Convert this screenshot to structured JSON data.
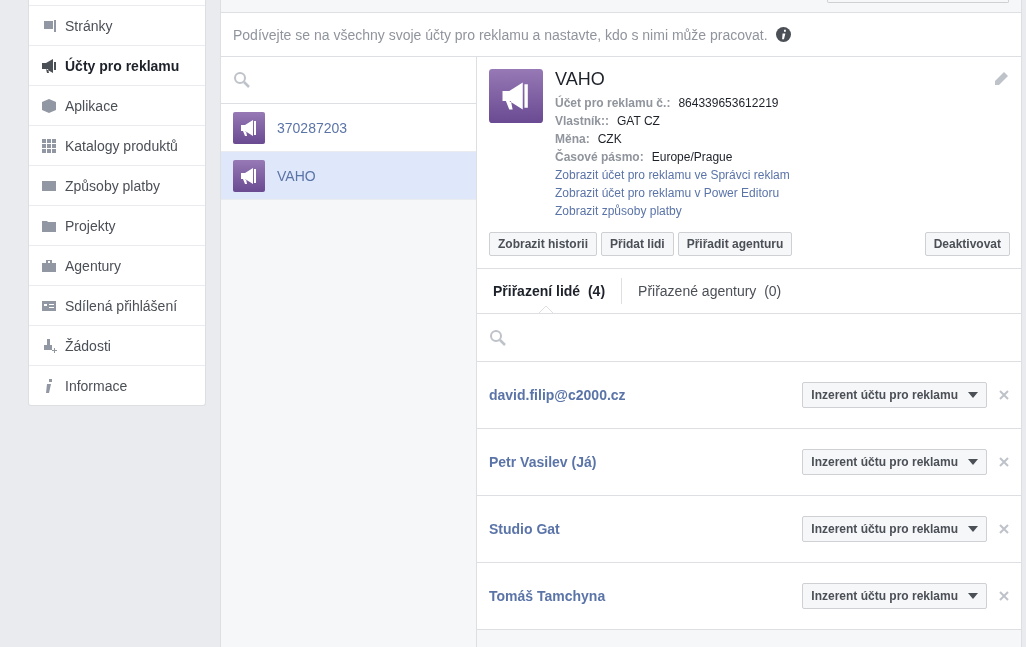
{
  "sidebar": {
    "items": [
      {
        "label": "Stránky",
        "kind": "flag",
        "selected": false
      },
      {
        "label": "Účty pro reklamu",
        "kind": "megaphone",
        "selected": true
      },
      {
        "label": "Aplikace",
        "kind": "cube",
        "selected": false
      },
      {
        "label": "Katalogy produktů",
        "kind": "grid",
        "selected": false
      },
      {
        "label": "Způsoby platby",
        "kind": "card",
        "selected": false
      },
      {
        "label": "Projekty",
        "kind": "folder",
        "selected": false
      },
      {
        "label": "Agentury",
        "kind": "briefcase",
        "selected": false
      },
      {
        "label": "Sdílená přihlášení",
        "kind": "idcard",
        "selected": false
      },
      {
        "label": "Žádosti",
        "kind": "personadd",
        "selected": false
      },
      {
        "label": "Informace",
        "kind": "info",
        "selected": false
      }
    ]
  },
  "description": "Podívejte se na všechny svoje účty pro reklamu a nastavte, kdo s nimi může pracovat.",
  "accounts": [
    {
      "name": "370287203",
      "selected": false
    },
    {
      "name": "VAHO",
      "selected": true
    }
  ],
  "detail": {
    "title": "VAHO",
    "fields": [
      {
        "label": "Účet pro reklamu č.:",
        "value": "864339653612219"
      },
      {
        "label": "Vlastník::",
        "value": "GAT CZ"
      },
      {
        "label": "Měna:",
        "value": "CZK"
      },
      {
        "label": "Časové pásmo:",
        "value": "Europe/Prague"
      }
    ],
    "links": [
      "Zobrazit účet pro reklamu ve Správci reklam",
      "Zobrazit účet pro reklamu v Power Editoru",
      "Zobrazit způsoby platby"
    ],
    "buttons": [
      "Zobrazit historii",
      "Přidat lidi",
      "Přiřadit agenturu"
    ],
    "deactivate_button": "Deaktivovat"
  },
  "tabs": [
    {
      "label": "Přiřazení lidé",
      "count": "(4)",
      "selected": true
    },
    {
      "label": "Přiřazené agentury",
      "count": "(0)",
      "selected": false
    }
  ],
  "people": [
    {
      "name": "david.filip@c2000.cz",
      "role": "Inzerent účtu pro reklamu"
    },
    {
      "name": "Petr Vasilev (Já)",
      "role": "Inzerent účtu pro reklamu"
    },
    {
      "name": "Studio Gat",
      "role": "Inzerent účtu pro reklamu"
    },
    {
      "name": "Tomáš Tamchyna",
      "role": "Inzerent účtu pro reklamu"
    }
  ]
}
